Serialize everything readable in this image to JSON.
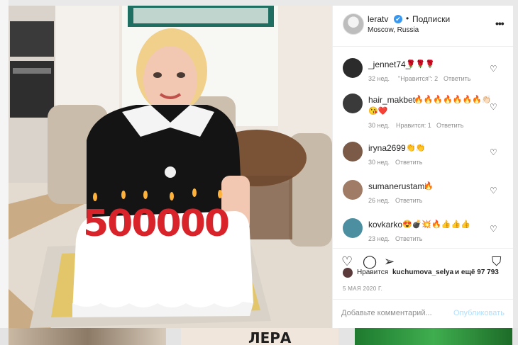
{
  "post": {
    "username": "leratv",
    "verified_mark": "✔",
    "separator": "•",
    "follow_label": "Подписки",
    "location": "Moscow, Russia",
    "more_icon": "more-dots-icon",
    "more_glyph": "•••",
    "cake_candles": "500000",
    "date": "5 МАЯ 2020 Г."
  },
  "comments": [
    {
      "user": "_jennet74_",
      "text": "🌹🌹🌹",
      "age": "32 нед.",
      "likes": "\"Нравится\": 2",
      "reply": "Ответить"
    },
    {
      "user": "hair_makbet",
      "text": "🔥🔥🔥🔥🔥🔥🔥👏🏻",
      "text2": "😘❤️",
      "age": "30 нед.",
      "likes": "Нравится: 1",
      "reply": "Ответить"
    },
    {
      "user": "iryna2699",
      "text": "👏👏",
      "age": "30 нед.",
      "reply": "Ответить"
    },
    {
      "user": "sumanerustami",
      "text": "🔥",
      "age": "26 нед.",
      "reply": "Ответить"
    },
    {
      "user": "kovkarko",
      "text": "😍💣💥🔥👍👍👍",
      "age": "23 нед.",
      "reply": "Ответить"
    }
  ],
  "likes_line": {
    "prefix": "Нравится",
    "user": "kuchumova_selya",
    "suffix": "и ещё 97 793"
  },
  "add_comment": {
    "placeholder": "Добавьте комментарий...",
    "publish_label": "Опубликовать"
  },
  "bottom_thumb_text": "ЛЕРА",
  "colors": {
    "link_blue": "#3897f0",
    "publish_disabled": "#b2dffc",
    "meta_gray": "#8e8e8e"
  }
}
